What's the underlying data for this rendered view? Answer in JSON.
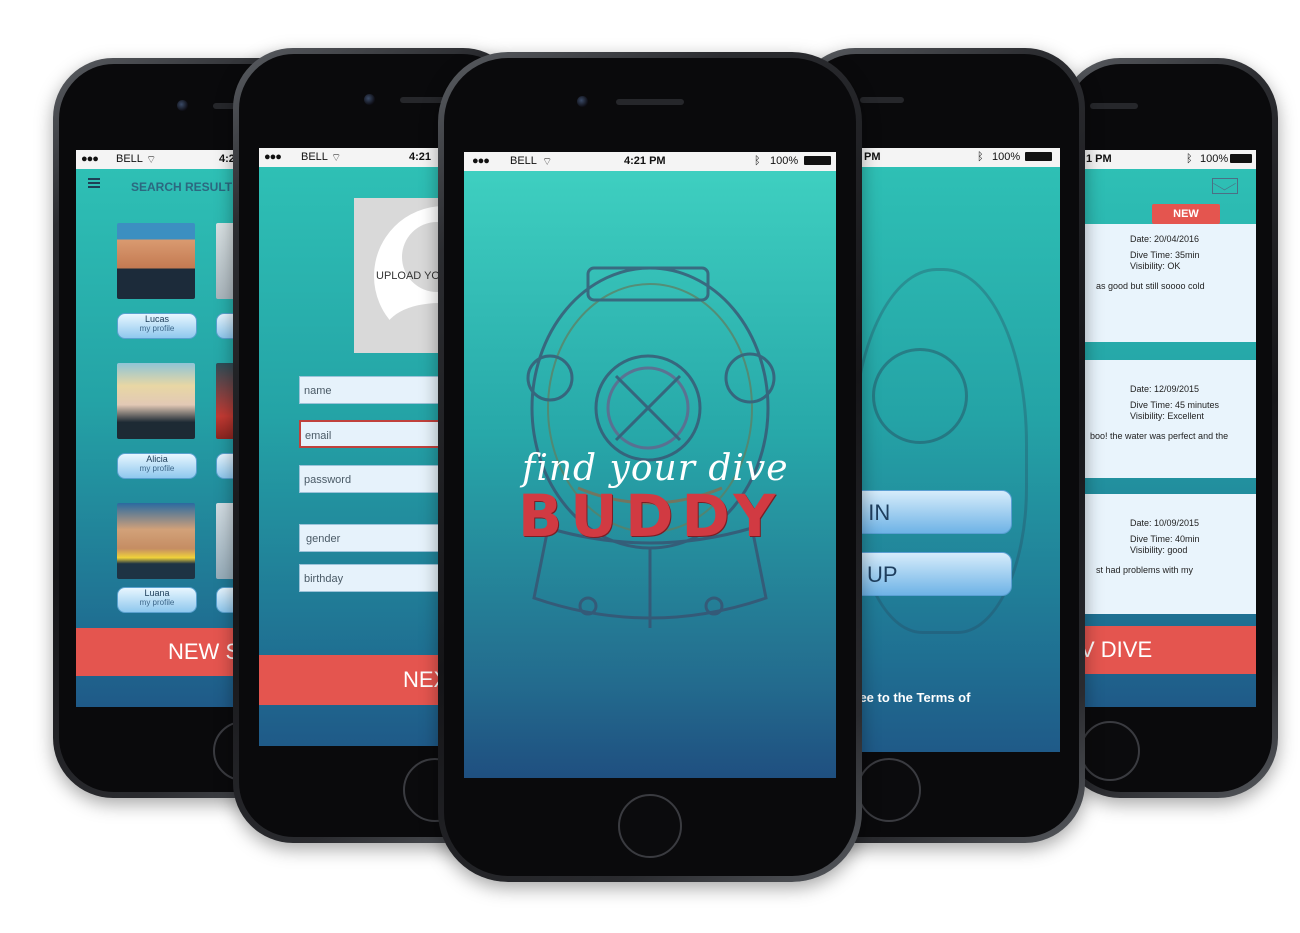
{
  "status_bar": {
    "carrier": "BELL",
    "time": "4:21 PM",
    "battery": "100%",
    "time_short_left": "4:2",
    "time_short_left2": "4:21",
    "time_right": "PM",
    "time_right2": "1 PM"
  },
  "search_screen": {
    "title": "SEARCH RESULT",
    "profiles": [
      {
        "name": "Lucas",
        "sub": "my profile"
      },
      {
        "name": "Alicia",
        "sub": "my profile"
      },
      {
        "name": "Luana",
        "sub": "my profile"
      }
    ],
    "button": "NEW S"
  },
  "signup_screen": {
    "upload_label": "UPLOAD YO",
    "fields": {
      "name": "name",
      "email": "email",
      "password": "password",
      "gender": "gender",
      "birthday": "birthday"
    },
    "button": "NEX"
  },
  "splash_screen": {
    "tagline": "find your dive",
    "title": "BUDDY"
  },
  "login_screen": {
    "login_button": "G IN",
    "signup_button": "N UP",
    "terms": "I agree to the Terms of"
  },
  "logbook_screen": {
    "badge": "NEW",
    "entries": [
      {
        "date": "Date: 20/04/2016",
        "dive_time": "Dive Time: 35min",
        "visibility": "Visibility: OK",
        "note": "as good but still soooo cold"
      },
      {
        "date": "Date: 12/09/2015",
        "dive_time": "Dive Time: 45 minutes",
        "visibility": "Visibility: Excellent",
        "note": "boo! the water was perfect and the"
      },
      {
        "date": "Date: 10/09/2015",
        "dive_time": "Dive Time: 40min",
        "visibility": "Visibility: good",
        "note": "st had problems with my"
      }
    ],
    "button": "V DIVE"
  },
  "colors": {
    "accent_red": "#e4554f",
    "teal": "#2fc2b6",
    "deep_blue": "#1f5a88"
  }
}
